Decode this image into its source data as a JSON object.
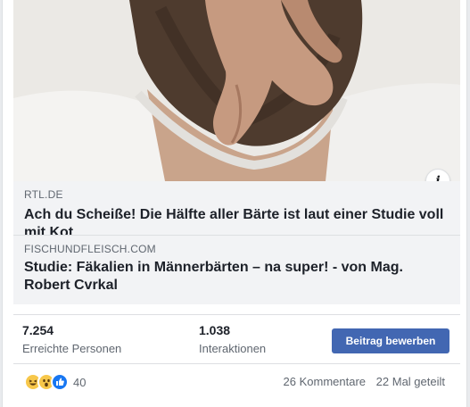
{
  "post": {
    "image_alt": "Mann mit Bart, Hand am Kinn",
    "info_icon_glyph": "i"
  },
  "link_preview_primary": {
    "domain": "RTL.DE",
    "headline": "Ach du Scheiße! Die Hälfte aller Bärte ist laut einer Studie voll mit Kot"
  },
  "link_preview_secondary": {
    "domain": "FISCHUNDFLEISCH.COM",
    "headline": "Studie: Fäkalien in Männerbärten – na super! - von Mag. Robert Cvrkal"
  },
  "stats": {
    "reach_value": "7.254",
    "reach_label": "Erreichte Personen",
    "engagement_value": "1.038",
    "engagement_label": "Interaktionen",
    "boost_label": "Beitrag bewerben"
  },
  "footer": {
    "reaction_icons": [
      "haha-icon",
      "wow-icon",
      "like-icon"
    ],
    "reaction_count": "40",
    "comments": "26 Kommentare",
    "shares": "22 Mal geteilt"
  },
  "colors": {
    "boost_button": "#4267b2",
    "preview_bg": "#f2f3f5",
    "like_blue": "#1877f2",
    "reaction_yellow": "#f7c74a"
  }
}
